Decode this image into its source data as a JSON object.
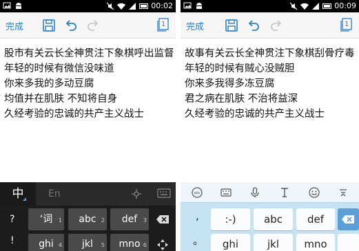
{
  "left": {
    "status": {
      "time": "00:02"
    },
    "toolbar": {
      "done_label": "完成",
      "page_count": "1"
    },
    "document": {
      "lines": [
        "股市有关云长全神贯注下象棋呼出监督",
        "年轻的时候有微信没味道",
        "你来多我的多动豆腐",
        "均值并在肌肤  不知将自身",
        "久经考验的忠诚的共产主义战士"
      ]
    },
    "keyboard": {
      "lang_active": "中",
      "lang_other": "En",
      "keys": [
        {
          "label": "‘词",
          "num": "1"
        },
        {
          "label": "abc",
          "num": "2"
        },
        {
          "label": "def",
          "num": "3"
        },
        {
          "label": "ghi",
          "num": "4"
        },
        {
          "label": "jkl",
          "num": "5"
        },
        {
          "label": "mno",
          "num": "6"
        }
      ],
      "side_keys": [
        "?",
        "!"
      ]
    }
  },
  "right": {
    "status": {
      "time": "00:09"
    },
    "toolbar": {
      "done_label": "完成",
      "page_count": "1"
    },
    "document": {
      "lines": [
        "故事有关云长全神贯注下象棋刮骨疗毒",
        "年轻的时候有贼心没贼胆",
        "你来多我得多冻豆腐",
        "君之病在肌肤  不治将益深",
        "久经考验的忠诚的共产主义战士"
      ]
    },
    "keyboard": {
      "keys": [
        ":-)",
        "abc",
        "def",
        "ghi",
        "jkl",
        "mno"
      ],
      "side_keys": [
        ",",
        "。"
      ]
    }
  },
  "icons": {
    "statusbar_left": [
      "image-icon",
      "android-icon"
    ],
    "statusbar_right": [
      "mute-icon",
      "wifi-icon",
      "sim-icon",
      "battery-icon"
    ],
    "toolbar": [
      "save-icon",
      "undo-icon",
      "redo-icon",
      "page-counter-icon"
    ],
    "keyboard_right_bar": [
      "emoji-keyboard-icon",
      "keyboard-icon",
      "mic-icon",
      "text-cursor-icon",
      "smiley-icon",
      "hide-keyboard-icon"
    ]
  },
  "colors": {
    "accent": "#2b7fc3",
    "left_keyboard_bg": "#1c1c1c",
    "right_keyboard_bg": "#c6e3f4",
    "delete_key": "#5b9fd6"
  }
}
